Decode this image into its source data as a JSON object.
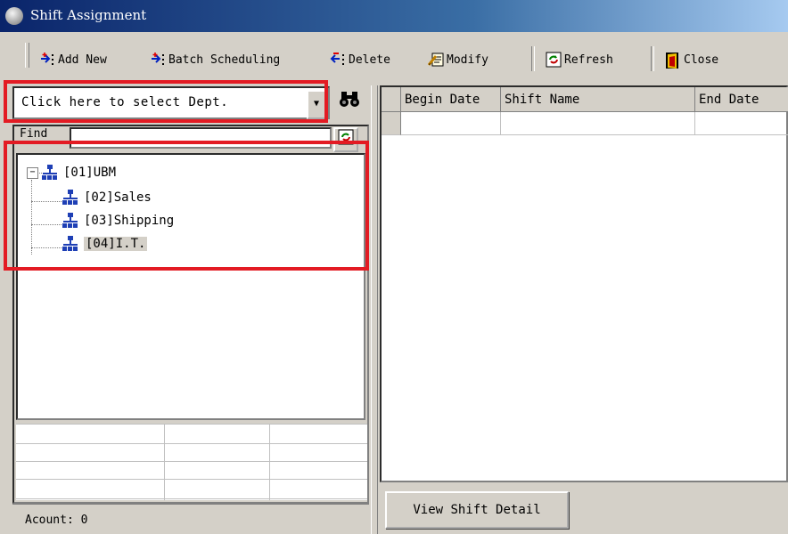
{
  "window": {
    "title": "Shift Assignment",
    "icon": "app-icon"
  },
  "toolbar": {
    "add_new": "Add New",
    "batch_scheduling": "Batch Scheduling",
    "delete": "Delete",
    "modify": "Modify",
    "refresh": "Refresh",
    "close": "Close"
  },
  "dept_select": {
    "value": "Click here to select Dept.",
    "options": [
      "Click here to select Dept."
    ]
  },
  "find": {
    "label": "Find",
    "value": ""
  },
  "tree": {
    "root": {
      "label": "[01]UBM",
      "expanded": true
    },
    "children": [
      {
        "label": "[02]Sales"
      },
      {
        "label": "[03]Shipping"
      },
      {
        "label": "[04]I.T.",
        "selected": true
      }
    ]
  },
  "status": {
    "text": "Acount: 0"
  },
  "grid": {
    "columns": [
      "Begin Date",
      "Shift Name",
      "End Date"
    ],
    "rows": []
  },
  "buttons": {
    "view_shift_detail": "View Shift Detail"
  },
  "colors": {
    "highlight": "#e31b23",
    "title_start": "#0a246a",
    "title_end": "#a6caf0",
    "org_icon": "#1e3fb5"
  }
}
